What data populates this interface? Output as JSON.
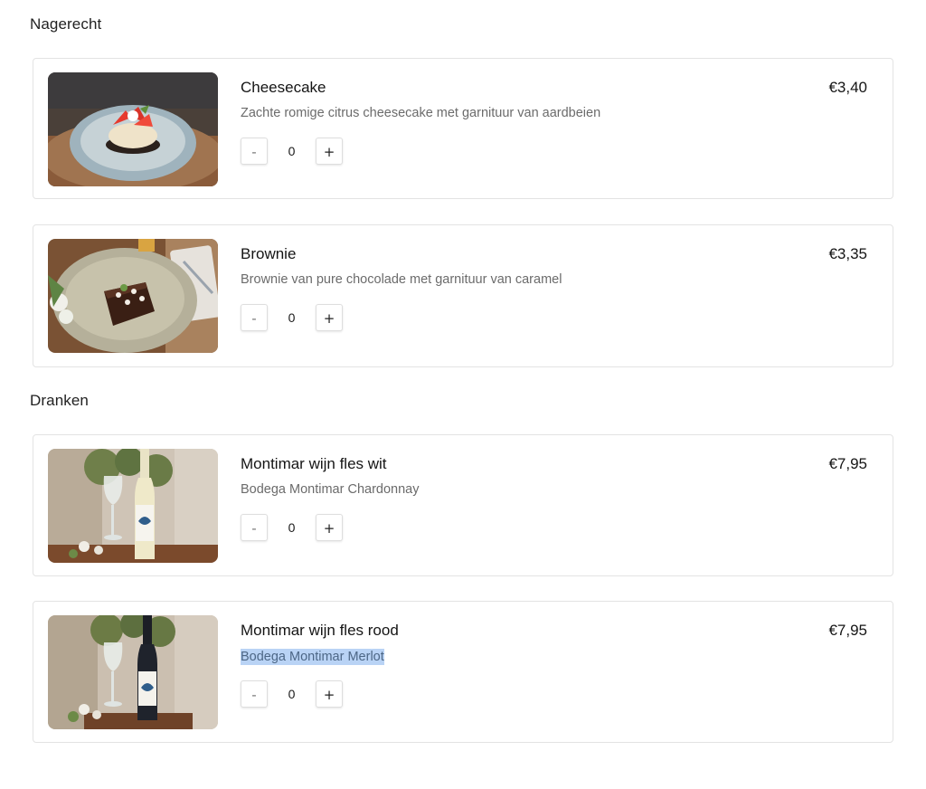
{
  "sections": [
    {
      "title": "Nagerecht",
      "items": [
        {
          "name": "Cheesecake",
          "description": "Zachte romige citrus cheesecake met garnituur van aardbeien",
          "price": "€3,40",
          "quantity": "0",
          "image_icon": "cheesecake-image"
        },
        {
          "name": "Brownie",
          "description": "Brownie van pure chocolade met garnituur van caramel",
          "price": "€3,35",
          "quantity": "0",
          "image_icon": "brownie-image"
        }
      ]
    },
    {
      "title": "Dranken",
      "items": [
        {
          "name": "Montimar wijn fles wit",
          "description": "Bodega Montimar Chardonnay",
          "price": "€7,95",
          "quantity": "0",
          "image_icon": "white-wine-bottle-image"
        },
        {
          "name": "Montimar wijn fles rood",
          "description": "Bodega Montimar Merlot",
          "price": "€7,95",
          "quantity": "0",
          "image_icon": "red-wine-bottle-image"
        }
      ]
    }
  ],
  "controls": {
    "minus_label": "-",
    "plus_label": "+"
  },
  "colors": {
    "selection_highlight": "#b9d3f5",
    "card_border": "#e3e3e3",
    "description_text": "#6b6b6b"
  }
}
